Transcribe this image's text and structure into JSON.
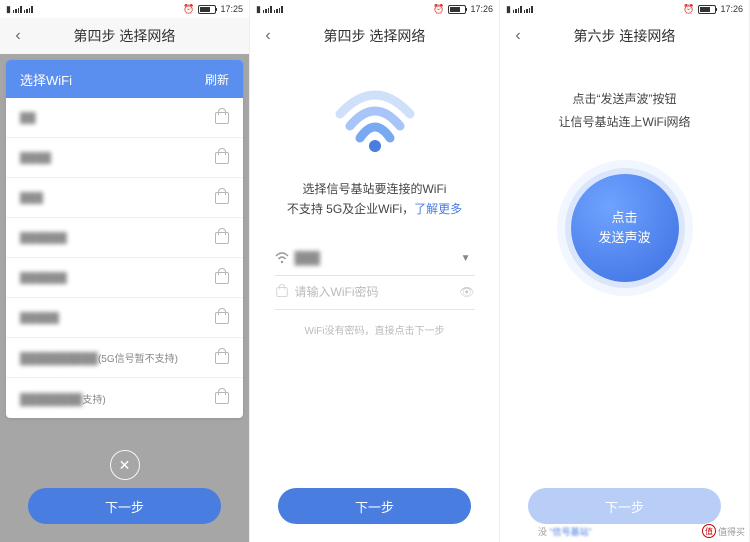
{
  "status": {
    "time1": "17:25",
    "time2": "17:26",
    "time3": "17:26"
  },
  "screen1": {
    "title": "第四步 选择网络",
    "card_title": "选择WiFi",
    "refresh": "刷新",
    "suffix_5g": "(5G信号暂不支持)",
    "suffix_support": "支持)",
    "next": "下一步",
    "rows": [
      "██",
      "████",
      "███",
      "██████",
      "██████",
      "█████",
      "██████████",
      "████████"
    ]
  },
  "screen2": {
    "title": "第四步 选择网络",
    "line1": "选择信号基站要连接的WiFi",
    "line2_a": "不支持 5G及企业WiFi，",
    "line2_link": "了解更多",
    "selected_wifi": "███",
    "pwd_placeholder": "请输入WiFi密码",
    "hint": "WiFi没有密码，直接点击下一步",
    "next": "下一步"
  },
  "screen3": {
    "title": "第六步 连接网络",
    "line1": "点击“发送声波”按钮",
    "line2": "让信号基站连上WiFi网络",
    "btn_l1": "点击",
    "btn_l2": "发送声波",
    "next": "下一步",
    "bottom_prefix": "没",
    "bottom_blur": "“信号基站”",
    "watermark": "值得买"
  }
}
